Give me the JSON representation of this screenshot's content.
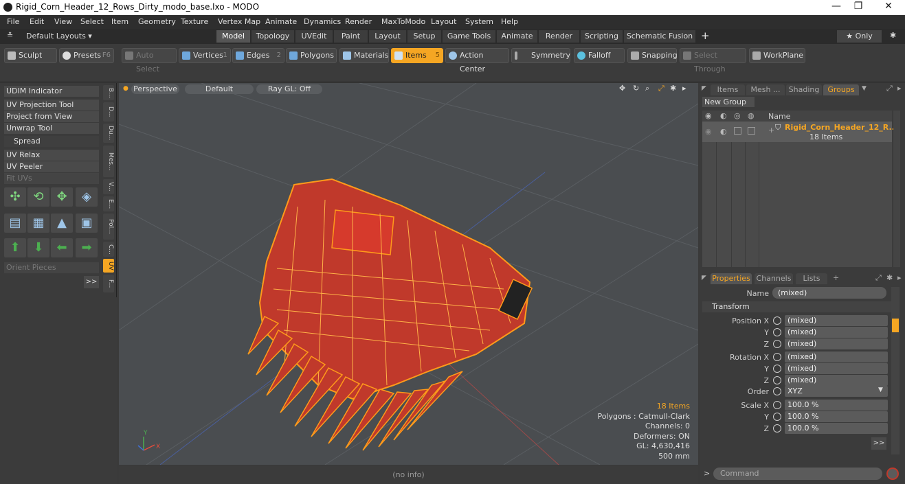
{
  "window": {
    "title": "Rigid_Corn_Header_12_Rows_Dirty_modo_base.lxo - MODO",
    "min": "—",
    "max": "❐",
    "close": "✕"
  },
  "menu": [
    "File",
    "Edit",
    "View",
    "Select",
    "Item",
    "Geometry",
    "Texture",
    "Vertex Map",
    "Animate",
    "Dynamics",
    "Render",
    "MaxToModo",
    "Layout",
    "System",
    "Help"
  ],
  "layout": {
    "default_layouts": "Default Layouts ▾",
    "tabs": [
      "Model",
      "Topology",
      "UVEdit",
      "Paint",
      "Layout",
      "Setup",
      "Game Tools",
      "Animate",
      "Render",
      "Scripting",
      "Schematic Fusion"
    ],
    "active_tab": "Model",
    "add": "+",
    "only": "★  Only",
    "gear": "✱"
  },
  "toolbar": {
    "sculpt": "Sculpt",
    "presets": "Presets",
    "presets_key": "F6",
    "auto_select": "Auto Select",
    "vertices": "Vertices",
    "vertices_key": "1",
    "edges": "Edges",
    "edges_key": "2",
    "polygons": "Polygons",
    "materials": "Materials",
    "items": "Items",
    "items_key": "5",
    "action_center": "Action Center",
    "symmetry": "Symmetry",
    "falloff": "Falloff",
    "snapping": "Snapping",
    "select_through": "Select Through",
    "workplane": "WorkPlane"
  },
  "left": {
    "tools": [
      "UDIM Indicator",
      "UV Projection Tool",
      "Project from View",
      "Unwrap Tool"
    ],
    "spread": "Spread",
    "tools2": [
      "UV Relax",
      "UV Peeler"
    ],
    "fit_uvs": "Fit UVs",
    "orient_pieces": "Orient Pieces",
    "more": ">>",
    "vtabs": [
      "B...",
      "D...",
      "Du...",
      "Mes...",
      "V...",
      "E...",
      "Pol...",
      "C...",
      "UV",
      "F..."
    ]
  },
  "viewport": {
    "view": "Perspective",
    "shading": "Default",
    "raygl": "Ray GL: Off",
    "stats": [
      "18 Items",
      "Polygons : Catmull-Clark",
      "Channels: 0",
      "Deformers: ON",
      "GL: 4,630,416",
      "500 mm"
    ],
    "status": "(no info)",
    "axis_y": "Y",
    "axis_x": "X"
  },
  "right": {
    "tabs": [
      "Items",
      "Mesh ...",
      "Shading",
      "Groups"
    ],
    "active_tab": "Groups",
    "new_group": "New Group",
    "col_name": "Name",
    "group_name": "Rigid_Corn_Header_12_R...",
    "group_count": "18 Items",
    "prop_tabs": [
      "Properties",
      "Channels",
      "Lists"
    ],
    "prop_add": "+",
    "name_label": "Name",
    "name_value": "(mixed)",
    "transform": "Transform",
    "rows": [
      {
        "label": "Position X",
        "value": "(mixed)"
      },
      {
        "label": "Y",
        "value": "(mixed)"
      },
      {
        "label": "Z",
        "value": "(mixed)"
      },
      {
        "label": "Rotation X",
        "value": "(mixed)"
      },
      {
        "label": "Y",
        "value": "(mixed)"
      },
      {
        "label": "Z",
        "value": "(mixed)"
      },
      {
        "label": "Order",
        "value": "XYZ"
      },
      {
        "label": "Scale X",
        "value": "100.0 %"
      },
      {
        "label": "Y",
        "value": "100.0 %"
      },
      {
        "label": "Z",
        "value": "100.0 %"
      }
    ],
    "more": ">>",
    "command": "Command",
    "prompt": ">"
  },
  "colors": {
    "accent": "#f5a623",
    "model_fill": "#c0392b",
    "model_wire": "#ff9a1a"
  }
}
